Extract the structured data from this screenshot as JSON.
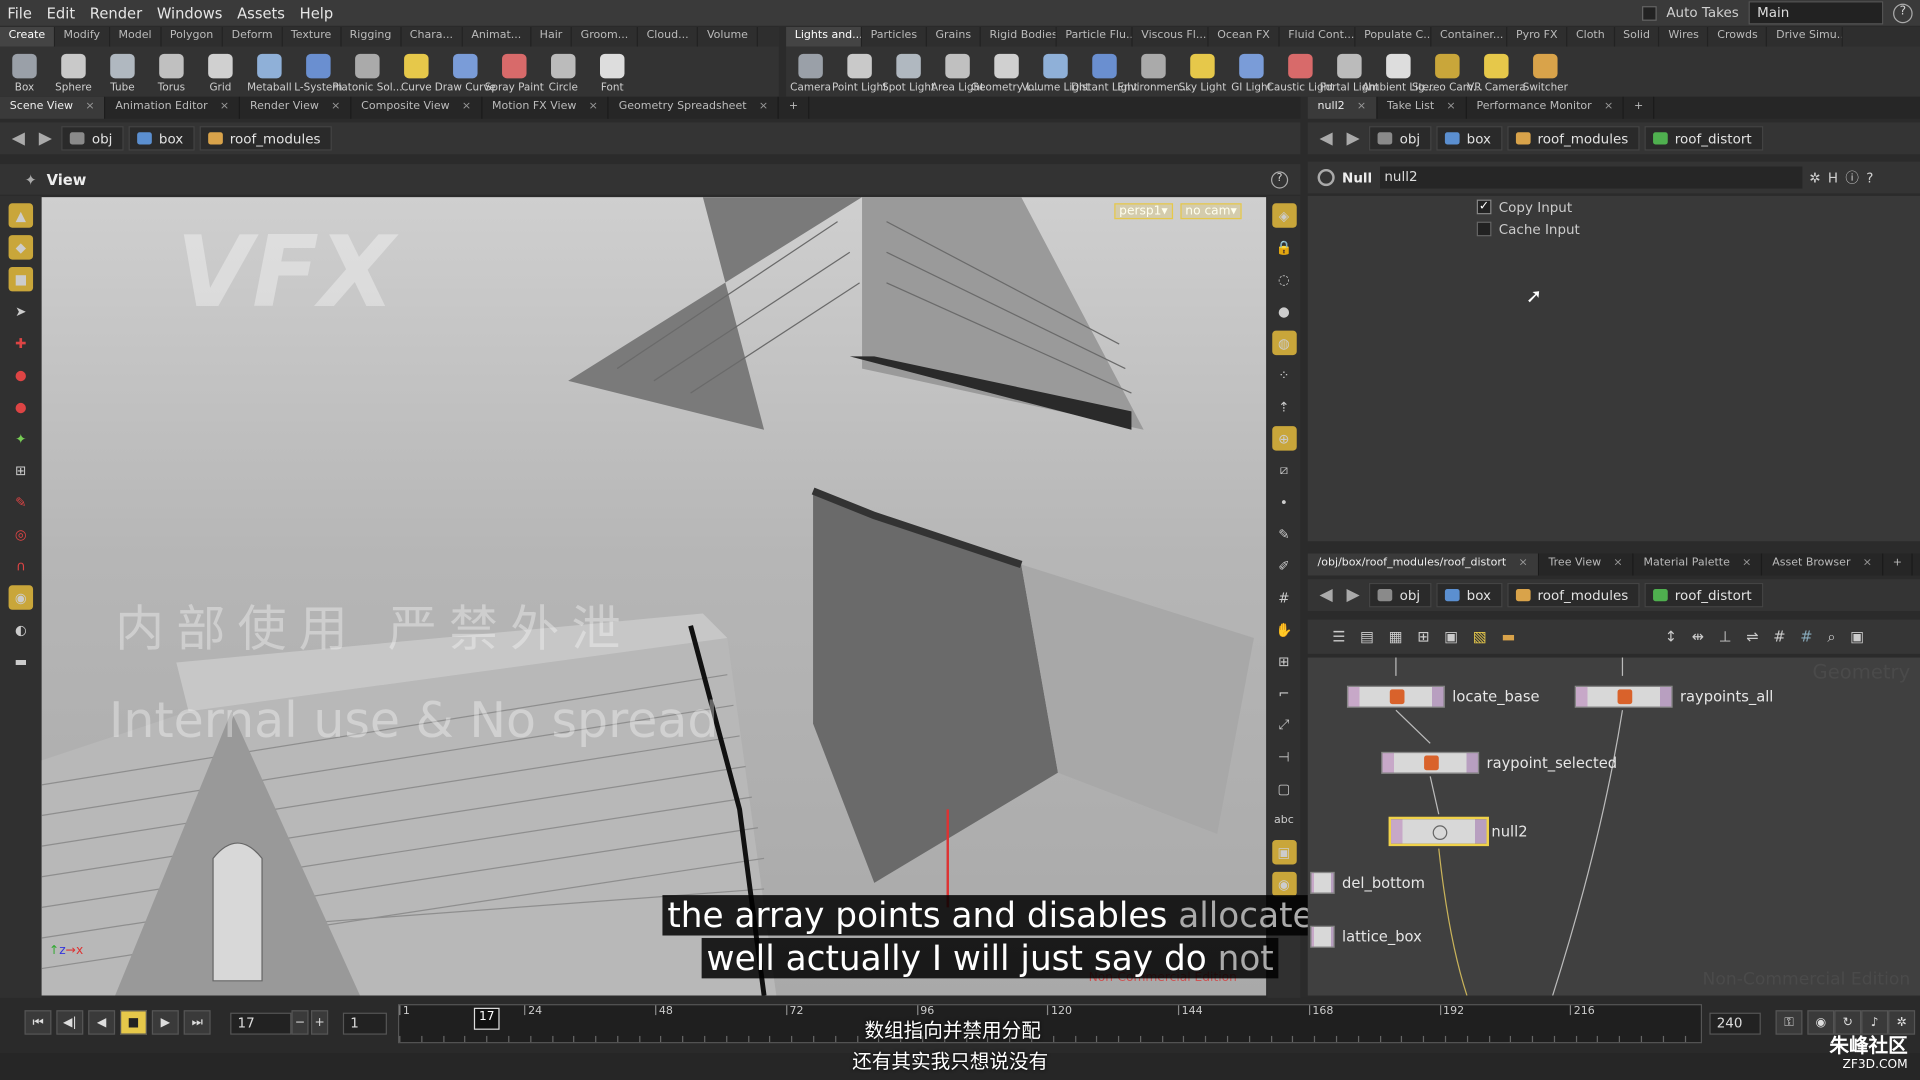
{
  "menubar": {
    "items": [
      "File",
      "Edit",
      "Render",
      "Windows",
      "Assets",
      "Help"
    ],
    "auto_takes": "Auto Takes",
    "desktop": "Main"
  },
  "shelf_left": {
    "tabs": [
      "Create",
      "Modify",
      "Model",
      "Polygon",
      "Deform",
      "Texture",
      "Rigging",
      "Chara...",
      "Animat...",
      "Hair",
      "Groom...",
      "Cloud...",
      "Volume"
    ],
    "tools": [
      "Box",
      "Sphere",
      "Tube",
      "Torus",
      "Grid",
      "Metaball",
      "L-System",
      "Platonic Sol...",
      "Curve",
      "Draw Curve",
      "Spray Paint",
      "Circle",
      "Font"
    ]
  },
  "shelf_right": {
    "tabs": [
      "Lights and...",
      "Particles",
      "Grains",
      "Rigid Bodies",
      "Particle Flu...",
      "Viscous Fl...",
      "Ocean FX",
      "Fluid Cont...",
      "Populate C...",
      "Container...",
      "Pyro FX",
      "Cloth",
      "Solid",
      "Wires",
      "Crowds",
      "Drive Simu..."
    ],
    "tools": [
      "Camera",
      "Point Light",
      "Spot Light",
      "Area Light",
      "Geometry L...",
      "Volume Light",
      "Distant Light",
      "Environmen...",
      "Sky Light",
      "GI Light",
      "Caustic Light",
      "Portal Light",
      "Ambient Lig...",
      "Stereo Cam...",
      "VR Camera",
      "Switcher"
    ]
  },
  "left_panetabs": [
    "Scene View",
    "Animation Editor",
    "Render View",
    "Composite View",
    "Motion FX View",
    "Geometry Spreadsheet"
  ],
  "left_path": [
    "obj",
    "box",
    "roof_modules"
  ],
  "viewer": {
    "title": "View",
    "cam_persp": "persp1▾",
    "cam_nocam": "no cam▾",
    "watermark_logo": "VFX",
    "watermark_cn": "内部使用 严禁外泄",
    "watermark_en": "Internal use & No spread",
    "edition": "Non-Commercial Edition"
  },
  "right_panetabs": [
    "null2",
    "Take List",
    "Performance Monitor"
  ],
  "right_path": [
    "obj",
    "box",
    "roof_modules",
    "roof_distort"
  ],
  "params": {
    "type": "Null",
    "name": "null2",
    "copy_input": "Copy Input",
    "cache_input": "Cache Input"
  },
  "net_panetabs": [
    "/obj/box/roof_modules/roof_distort",
    "Tree View",
    "Material Palette",
    "Asset Browser"
  ],
  "net_path": [
    "obj",
    "box",
    "roof_modules",
    "roof_distort"
  ],
  "network": {
    "context_label": "Geometry",
    "edition": "Non-Commercial Edition",
    "nodes": {
      "locate_base": "locate_base",
      "raypoints_all": "raypoints_all",
      "raypoint_selected": "raypoint_selected",
      "null2": "null2",
      "del_bottom": "del_bottom",
      "lattice_box": "lattice_box"
    }
  },
  "subtitles": {
    "line1_a": "the array points and disables",
    "line1_b": " allocate",
    "line2_a": "well actually I will just say do",
    "line2_b": " not",
    "cn1": "数组指向并禁用分配",
    "cn2": "还有其实我只想说没有"
  },
  "timeline": {
    "current_frame": "17",
    "start_frame": "17",
    "step": "1",
    "end_frame": "240",
    "ticks": [
      "1",
      "24",
      "48",
      "72",
      "96",
      "120",
      "144",
      "168",
      "192",
      "216"
    ],
    "playhead_label": "17"
  },
  "logo": {
    "cn": "朱峰社区",
    "site": "ZF3D.COM"
  }
}
